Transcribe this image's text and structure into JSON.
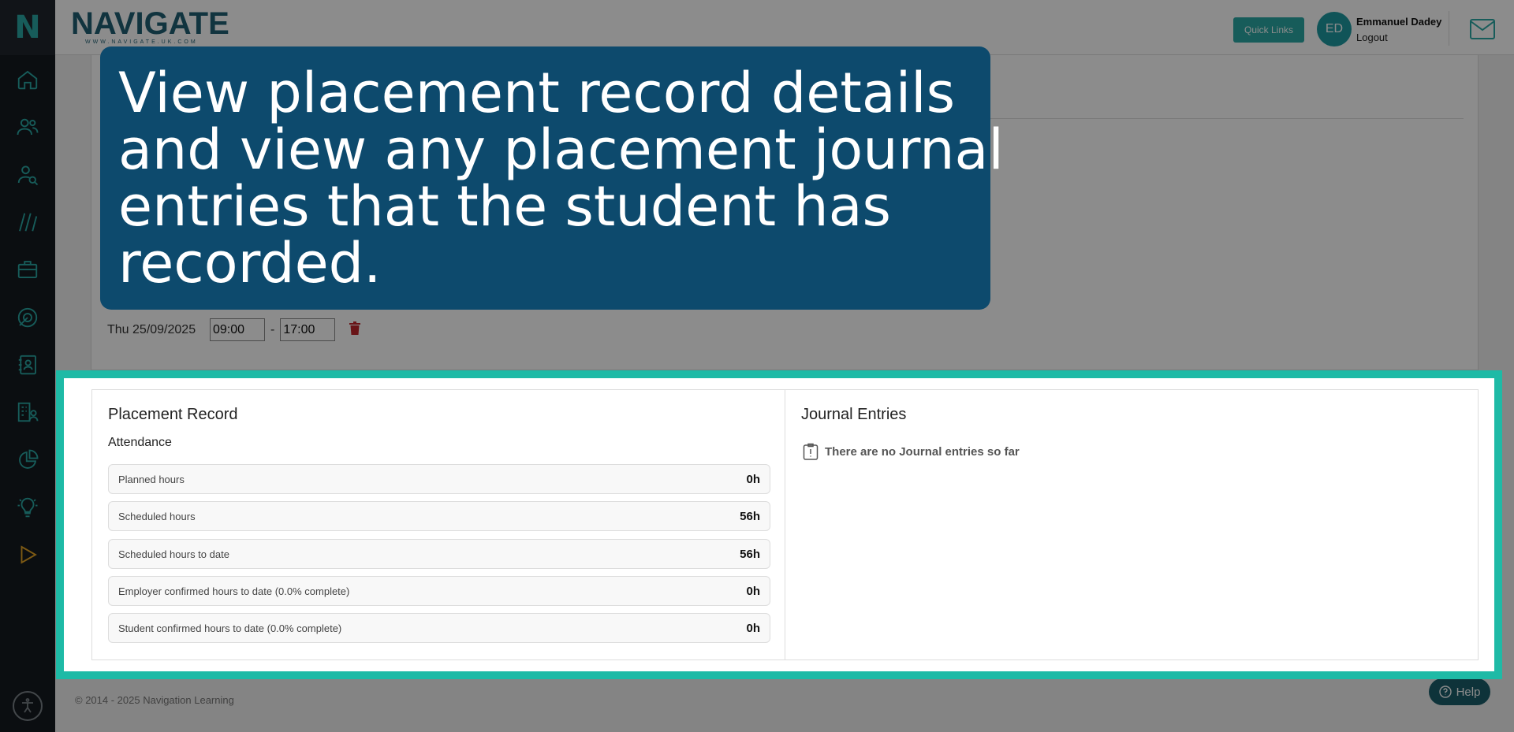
{
  "sidebar": {
    "logo": "N",
    "items": [
      {
        "icon": "home-icon"
      },
      {
        "icon": "users-icon"
      },
      {
        "icon": "user-search-icon"
      },
      {
        "icon": "library-icon"
      },
      {
        "icon": "briefcase-icon"
      },
      {
        "icon": "target-icon"
      },
      {
        "icon": "contact-card-icon"
      },
      {
        "icon": "building-user-icon"
      },
      {
        "icon": "pie-chart-icon"
      },
      {
        "icon": "lightbulb-icon"
      },
      {
        "icon": "play-icon"
      }
    ]
  },
  "header": {
    "brand_name": "NAVIGATE",
    "brand_url": "WWW.NAVIGATE.UK.COM",
    "quick_links": "Quick Links",
    "avatar_initials": "ED",
    "user_name": "Emmanuel Dadey",
    "logout": "Logout"
  },
  "schedule": {
    "date": "Thu 25/09/2025",
    "start": "09:00",
    "end": "17:00"
  },
  "callout": {
    "text": "View placement record details and view any placement journal entries that the student has recorded."
  },
  "placement_record": {
    "title": "Placement Record",
    "subtitle": "Attendance",
    "rows": [
      {
        "label": "Planned hours",
        "value": "0h"
      },
      {
        "label": "Scheduled hours",
        "value": "56h"
      },
      {
        "label": "Scheduled hours to date",
        "value": "56h"
      },
      {
        "label": "Employer confirmed hours to date (0.0% complete)",
        "value": "0h"
      },
      {
        "label": "Student confirmed hours to date (0.0% complete)",
        "value": "0h"
      }
    ]
  },
  "journal": {
    "title": "Journal Entries",
    "empty": "There are no Journal entries so far"
  },
  "footer": {
    "copyright": "© 2014 - 2025 Navigation Learning",
    "help": "Help"
  },
  "colors": {
    "accent": "#2aa8a4",
    "callout_bg": "#0d4a6d",
    "highlight": "#1ebaa6",
    "sidebar": "#141a1f"
  }
}
